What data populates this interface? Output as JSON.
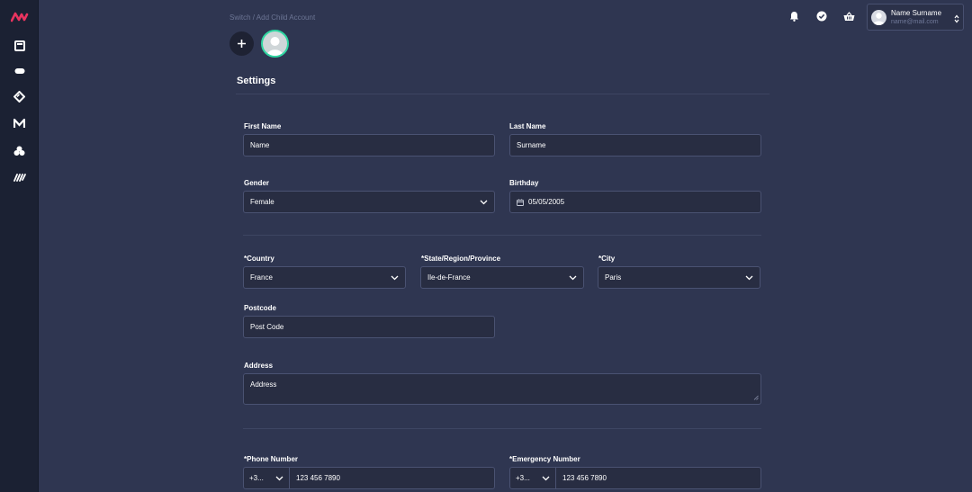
{
  "breadcrumb": "Switch / Add Child Account",
  "settings_title": "Settings",
  "user": {
    "name": "Name Surname",
    "email": "name@mail.com"
  },
  "sidebar": {
    "items": [
      {
        "icon": "logo-icon"
      },
      {
        "icon": "square-icon"
      },
      {
        "icon": "pill-icon"
      },
      {
        "icon": "diamond-icon"
      },
      {
        "icon": "m-icon"
      },
      {
        "icon": "clover-icon"
      },
      {
        "icon": "brush-icon"
      }
    ]
  },
  "topbar": {
    "icons": [
      "bell-icon",
      "check-circle-icon",
      "basket-icon"
    ]
  },
  "form": {
    "first_name": {
      "label": "First Name",
      "value": "Name"
    },
    "last_name": {
      "label": "Last Name",
      "value": "Surname"
    },
    "gender": {
      "label": "Gender",
      "value": "Female"
    },
    "birthday": {
      "label": "Birthday",
      "value": "05/05/2005"
    },
    "country": {
      "label": "*Country",
      "value": "France"
    },
    "state": {
      "label": "*State/Region/Province",
      "value": "Ile-de-France"
    },
    "city": {
      "label": "*City",
      "value": "Paris"
    },
    "postcode": {
      "label": "Postcode",
      "value": "Post Code"
    },
    "address": {
      "label": "Address",
      "value": "Address"
    },
    "phone": {
      "label": "*Phone Number",
      "prefix": "+3...",
      "value": "123 456 7890"
    },
    "emergency": {
      "label": "*Emergency Number",
      "prefix": "+3...",
      "value": "123 456 7890"
    }
  },
  "colors": {
    "background": "#2f3651",
    "sidebar": "#1b2133",
    "brand": "#e8345f",
    "field_bg": "#282d42",
    "accent_green": "#2fd6a1"
  }
}
